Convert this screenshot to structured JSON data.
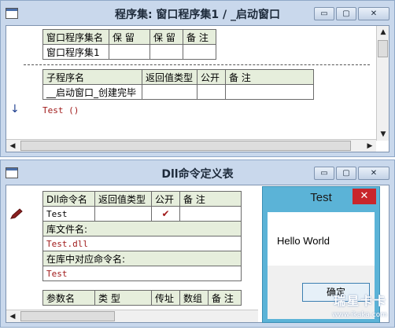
{
  "window1": {
    "title": "程序集: 窗口程序集1 / _启动窗口",
    "assembly_table": {
      "headers": [
        "窗口程序集名",
        "保 留",
        "保 留",
        "备 注"
      ],
      "row": [
        "窗口程序集1",
        "",
        "",
        ""
      ]
    },
    "sub_table": {
      "headers": [
        "子程序名",
        "返回值类型",
        "公开",
        "备 注"
      ],
      "row": [
        "__启动窗口_创建完毕",
        "",
        "",
        ""
      ]
    },
    "code_line": "Test ()",
    "arrow_marker": "↓"
  },
  "window2": {
    "title": "Dll命令定义表",
    "dll_table": {
      "headers": [
        "Dll命令名",
        "返回值类型",
        "公开",
        "备 注"
      ],
      "row_name": "Test",
      "row_public_check": "✔",
      "lib_label": "库文件名:",
      "lib_value": "Test.dll",
      "cmd_label": "在库中对应命令名:",
      "cmd_value": "Test",
      "param_headers": [
        "参数名",
        "类 型",
        "传址",
        "数组",
        "备 注"
      ]
    }
  },
  "msgbox": {
    "title": "Test",
    "close": "✕",
    "message": "Hello World",
    "ok": "确定"
  },
  "window_buttons": {
    "minimize": "▭",
    "maximize": "▢",
    "close": "✕"
  },
  "watermark": {
    "brand": "瑞星卡卡",
    "url": "www.ikaka.com"
  },
  "colors": {
    "frame": "#c9d8ec",
    "table_header": "#e6eedc",
    "code_text": "#a01a1a",
    "msgbox_frame": "#5bb3d7",
    "close_red": "#c8262b"
  }
}
